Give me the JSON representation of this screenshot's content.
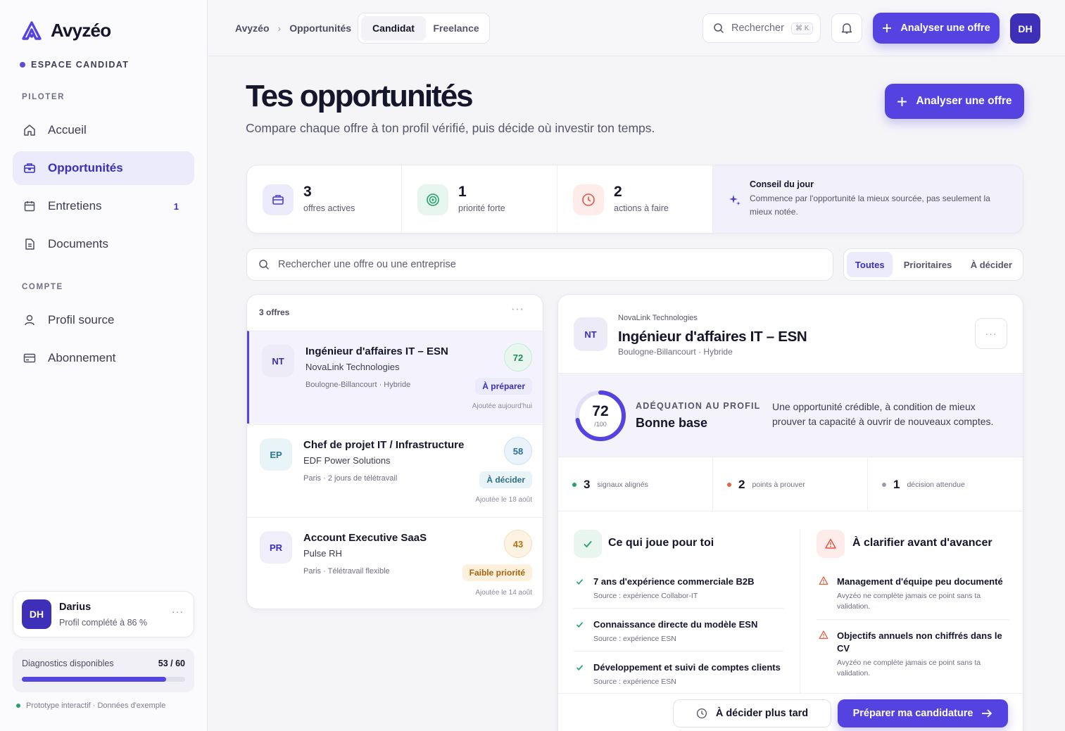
{
  "brand": {
    "name": "Avyzéo",
    "accent": "#5443e0"
  },
  "sidebar": {
    "space_label": "ESPACE CANDIDAT",
    "section_pilot": "PILOTER",
    "section_account": "COMPTE",
    "items": [
      {
        "label": "Accueil",
        "icon": "home-icon"
      },
      {
        "label": "Opportunités",
        "icon": "briefcase-icon"
      },
      {
        "label": "Entretiens",
        "icon": "calendar-icon",
        "badge": "1"
      },
      {
        "label": "Documents",
        "icon": "document-icon"
      },
      {
        "label": "Profil source",
        "icon": "user-icon"
      },
      {
        "label": "Abonnement",
        "icon": "card-icon"
      }
    ],
    "user": {
      "initials": "DH",
      "name": "Darius",
      "status": "Profil complété à 86 %"
    },
    "diagnostics": {
      "label": "Diagnostics disponibles",
      "count": "53 / 60",
      "used": 53,
      "total": 60
    },
    "footer_note": "Prototype interactif · Données d'exemple"
  },
  "header": {
    "breadcrumb": [
      "Avyzéo",
      "Opportunités"
    ],
    "segments": [
      "Candidat",
      "Freelance"
    ],
    "search_placeholder": "Rechercher",
    "search_shortcut": "⌘ K",
    "cta": "Analyser une offre",
    "user_initials": "DH"
  },
  "page": {
    "title": "Tes opportunités",
    "subtitle": "Compare chaque offre à ton profil vérifié, puis décide où investir ton temps.",
    "cta": "Analyser une offre"
  },
  "stats": [
    {
      "value": "3",
      "label": "offres actives"
    },
    {
      "value": "1",
      "label": "priorité forte"
    },
    {
      "value": "2",
      "label": "actions à faire"
    }
  ],
  "tip": {
    "title": "Conseil du jour",
    "text": "Commence par l'opportunité la mieux sourcée, pas seulement la mieux notée."
  },
  "filters": {
    "search_placeholder": "Rechercher une offre ou une entreprise",
    "chips": [
      "Toutes",
      "Prioritaires",
      "À décider"
    ]
  },
  "offers": {
    "count_label": "3 offres",
    "items": [
      {
        "initials": "NT",
        "title": "Ingénieur d'affaires IT – ESN",
        "company": "NovaLink Technologies",
        "meta": "Boulogne-Billancourt · Hybride",
        "score": "72",
        "status": "À préparer",
        "added": "Ajoutée aujourd'hui"
      },
      {
        "initials": "EP",
        "title": "Chef de projet IT / Infrastructure",
        "company": "EDF Power Solutions",
        "meta": "Paris · 2 jours de télétravail",
        "score": "58",
        "status": "À décider",
        "added": "Ajoutée le 18 août"
      },
      {
        "initials": "PR",
        "title": "Account Executive SaaS",
        "company": "Pulse RH",
        "meta": "Paris · Télétravail flexible",
        "score": "43",
        "status": "Faible priorité",
        "added": "Ajoutée le 14 août"
      }
    ]
  },
  "detail": {
    "initials": "NT",
    "company": "NovaLink Technologies",
    "title": "Ingénieur d'affaires IT – ESN",
    "meta": "Boulogne-Billancourt · Hybride",
    "fit": {
      "score": "72",
      "score_value": 72,
      "denominator": "/100",
      "label": "ADÉQUATION AU PROFIL",
      "value": "Bonne base",
      "description": "Une opportunité crédible, à condition de mieux prouver ta capacité à ouvrir de nouveaux comptes."
    },
    "signals": [
      {
        "value": "3",
        "label": "signaux alignés",
        "color": "#25a36b"
      },
      {
        "value": "2",
        "label": "points à prouver",
        "color": "#e8643f"
      },
      {
        "value": "1",
        "label": "décision attendue",
        "color": "#9a9aae"
      }
    ],
    "pros": {
      "title": "Ce qui joue pour toi",
      "items": [
        {
          "title": "7 ans d'expérience commerciale B2B",
          "source": "Source : expérience Collabor-IT"
        },
        {
          "title": "Connaissance directe du modèle ESN",
          "source": "Source : expérience ESN"
        },
        {
          "title": "Développement et suivi de comptes clients",
          "source": "Source : expérience ESN"
        }
      ]
    },
    "cons": {
      "title": "À clarifier avant d'avancer",
      "items": [
        {
          "title": "Management d'équipe peu documenté",
          "source": "Avyzéo ne complète jamais ce point sans ta validation."
        },
        {
          "title": "Objectifs annuels non chiffrés dans le CV",
          "source": "Avyzéo ne complète jamais ce point sans ta validation."
        }
      ]
    },
    "actions": {
      "later": "À décider plus tard",
      "prepare": "Préparer ma candidature"
    }
  }
}
